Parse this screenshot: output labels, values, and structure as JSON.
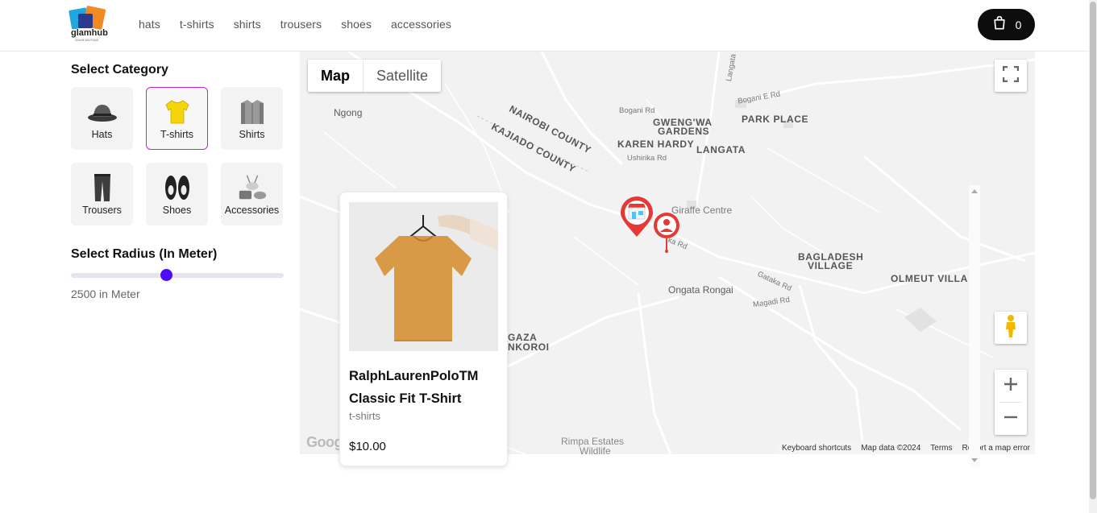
{
  "brand": {
    "logo_text": "glamhub",
    "logo_tagline": "ONLINE BOUTIQUE"
  },
  "nav": {
    "items": [
      "hats",
      "t-shirts",
      "shirts",
      "trousers",
      "shoes",
      "accessories"
    ]
  },
  "cart": {
    "count": "0"
  },
  "sidebar": {
    "category_title": "Select Category",
    "categories": [
      {
        "label": "Hats",
        "icon": "hat-icon",
        "selected": false
      },
      {
        "label": "T-shirts",
        "icon": "tshirt-icon",
        "selected": true
      },
      {
        "label": "Shirts",
        "icon": "shirt-icon",
        "selected": false
      },
      {
        "label": "Trousers",
        "icon": "trousers-icon",
        "selected": false
      },
      {
        "label": "Shoes",
        "icon": "shoes-icon",
        "selected": false
      },
      {
        "label": "Accessories",
        "icon": "accessories-icon",
        "selected": false
      }
    ],
    "radius_title": "Select Radius (In Meter)",
    "radius_value": 2500,
    "radius_text": "2500 in Meter"
  },
  "map": {
    "type_map": "Map",
    "type_satellite": "Satellite",
    "places": {
      "ngong": "Ngong",
      "nairobi_county": "NAIROBI COUNTY",
      "kajiado_county": "KAJIADO COUNTY",
      "gwengwa": "GWENG'WA",
      "gardens": "GARDENS",
      "karen_hardy": "KAREN HARDY",
      "langata": "LANGATA",
      "park_place": "PARK PLACE",
      "giraffe_centre": "Giraffe Centre",
      "bagladesh": "BAGLADESH",
      "village": "VILLAGE",
      "olmeut": "OLMEUT VILLA",
      "ongata_rongai": "Ongata Rongai",
      "gaza": "GAZA",
      "nkoroi": "NKOROI",
      "rimpa": "Rimpa Estates",
      "wildlife": "Wildlife"
    },
    "roads": {
      "bogani": "Bogani Rd",
      "bogani_e": "Bogani E Rd",
      "ushirika": "Ushirika Rd",
      "langata_s": "Langata S Rd",
      "gataka": "Gataka Rd",
      "magadi": "Magadi Rd",
      "ka": "ka Rd"
    },
    "footer": {
      "shortcuts": "Keyboard shortcuts",
      "data": "Map data ©2024",
      "terms": "Terms",
      "report": "Report a map error"
    },
    "google": "Google"
  },
  "product": {
    "name": "RalphLaurenPoloTM Classic Fit T-Shirt",
    "category": "t-shirts",
    "price": "$10.00"
  }
}
